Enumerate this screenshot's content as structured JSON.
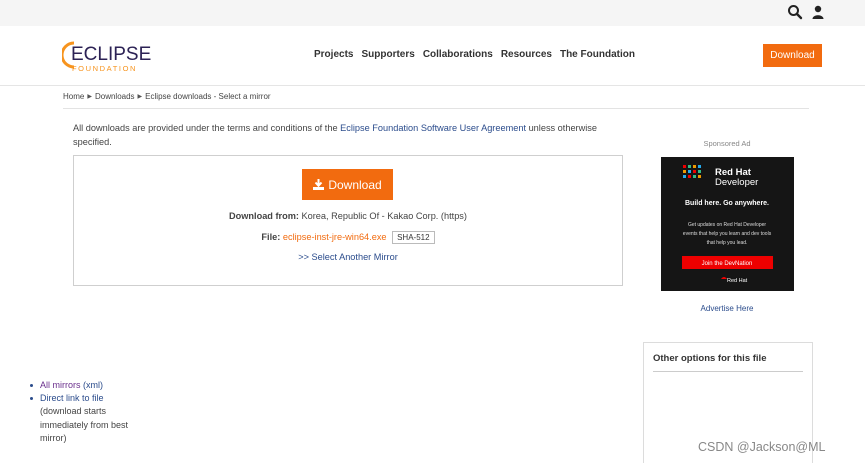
{
  "topbar": {
    "search_icon": "search-icon",
    "user_icon": "user-icon"
  },
  "header": {
    "logo_text": "ECLIPSE",
    "logo_sub": "FOUNDATION",
    "nav": [
      "Projects",
      "Supporters",
      "Collaborations",
      "Resources",
      "The Foundation"
    ],
    "download_label": "Download"
  },
  "breadcrumb": [
    "Home",
    "Downloads",
    "Eclipse downloads - Select a mirror"
  ],
  "intro": {
    "before": "All downloads are provided under the terms and conditions of the ",
    "link": "Eclipse Foundation Software User Agreement",
    "after": " unless otherwise specified."
  },
  "download_box": {
    "button_label": "Download",
    "from_label": "Download from:",
    "from_value": " Korea, Republic Of - Kakao Corp. (https)",
    "file_label": "File:",
    "file_name": "eclipse-inst-jre-win64.exe",
    "sha_label": "SHA-512",
    "mirror_link": ">> Select Another Mirror"
  },
  "ad": {
    "label": "Sponsored Ad",
    "brand_line1": "Red Hat",
    "brand_line2": "Developer",
    "tagline": "Build here. Go anywhere.",
    "body": "Get updates on Red Hat Developer events that help you learn and dev tools that help you lead.",
    "cta": "Join the DevNation",
    "footer": "Red Hat",
    "advertise": "Advertise Here"
  },
  "options": {
    "title": "Other options for this file",
    "all_mirrors": "All mirrors",
    "xml": "(xml)",
    "direct_link": "Direct link to file",
    "direct_note": "(download starts immediately from best mirror)"
  },
  "watermark": "CSDN @Jackson@ML",
  "colors": {
    "accent": "#f26b0f",
    "link": "#2b4c8c"
  }
}
